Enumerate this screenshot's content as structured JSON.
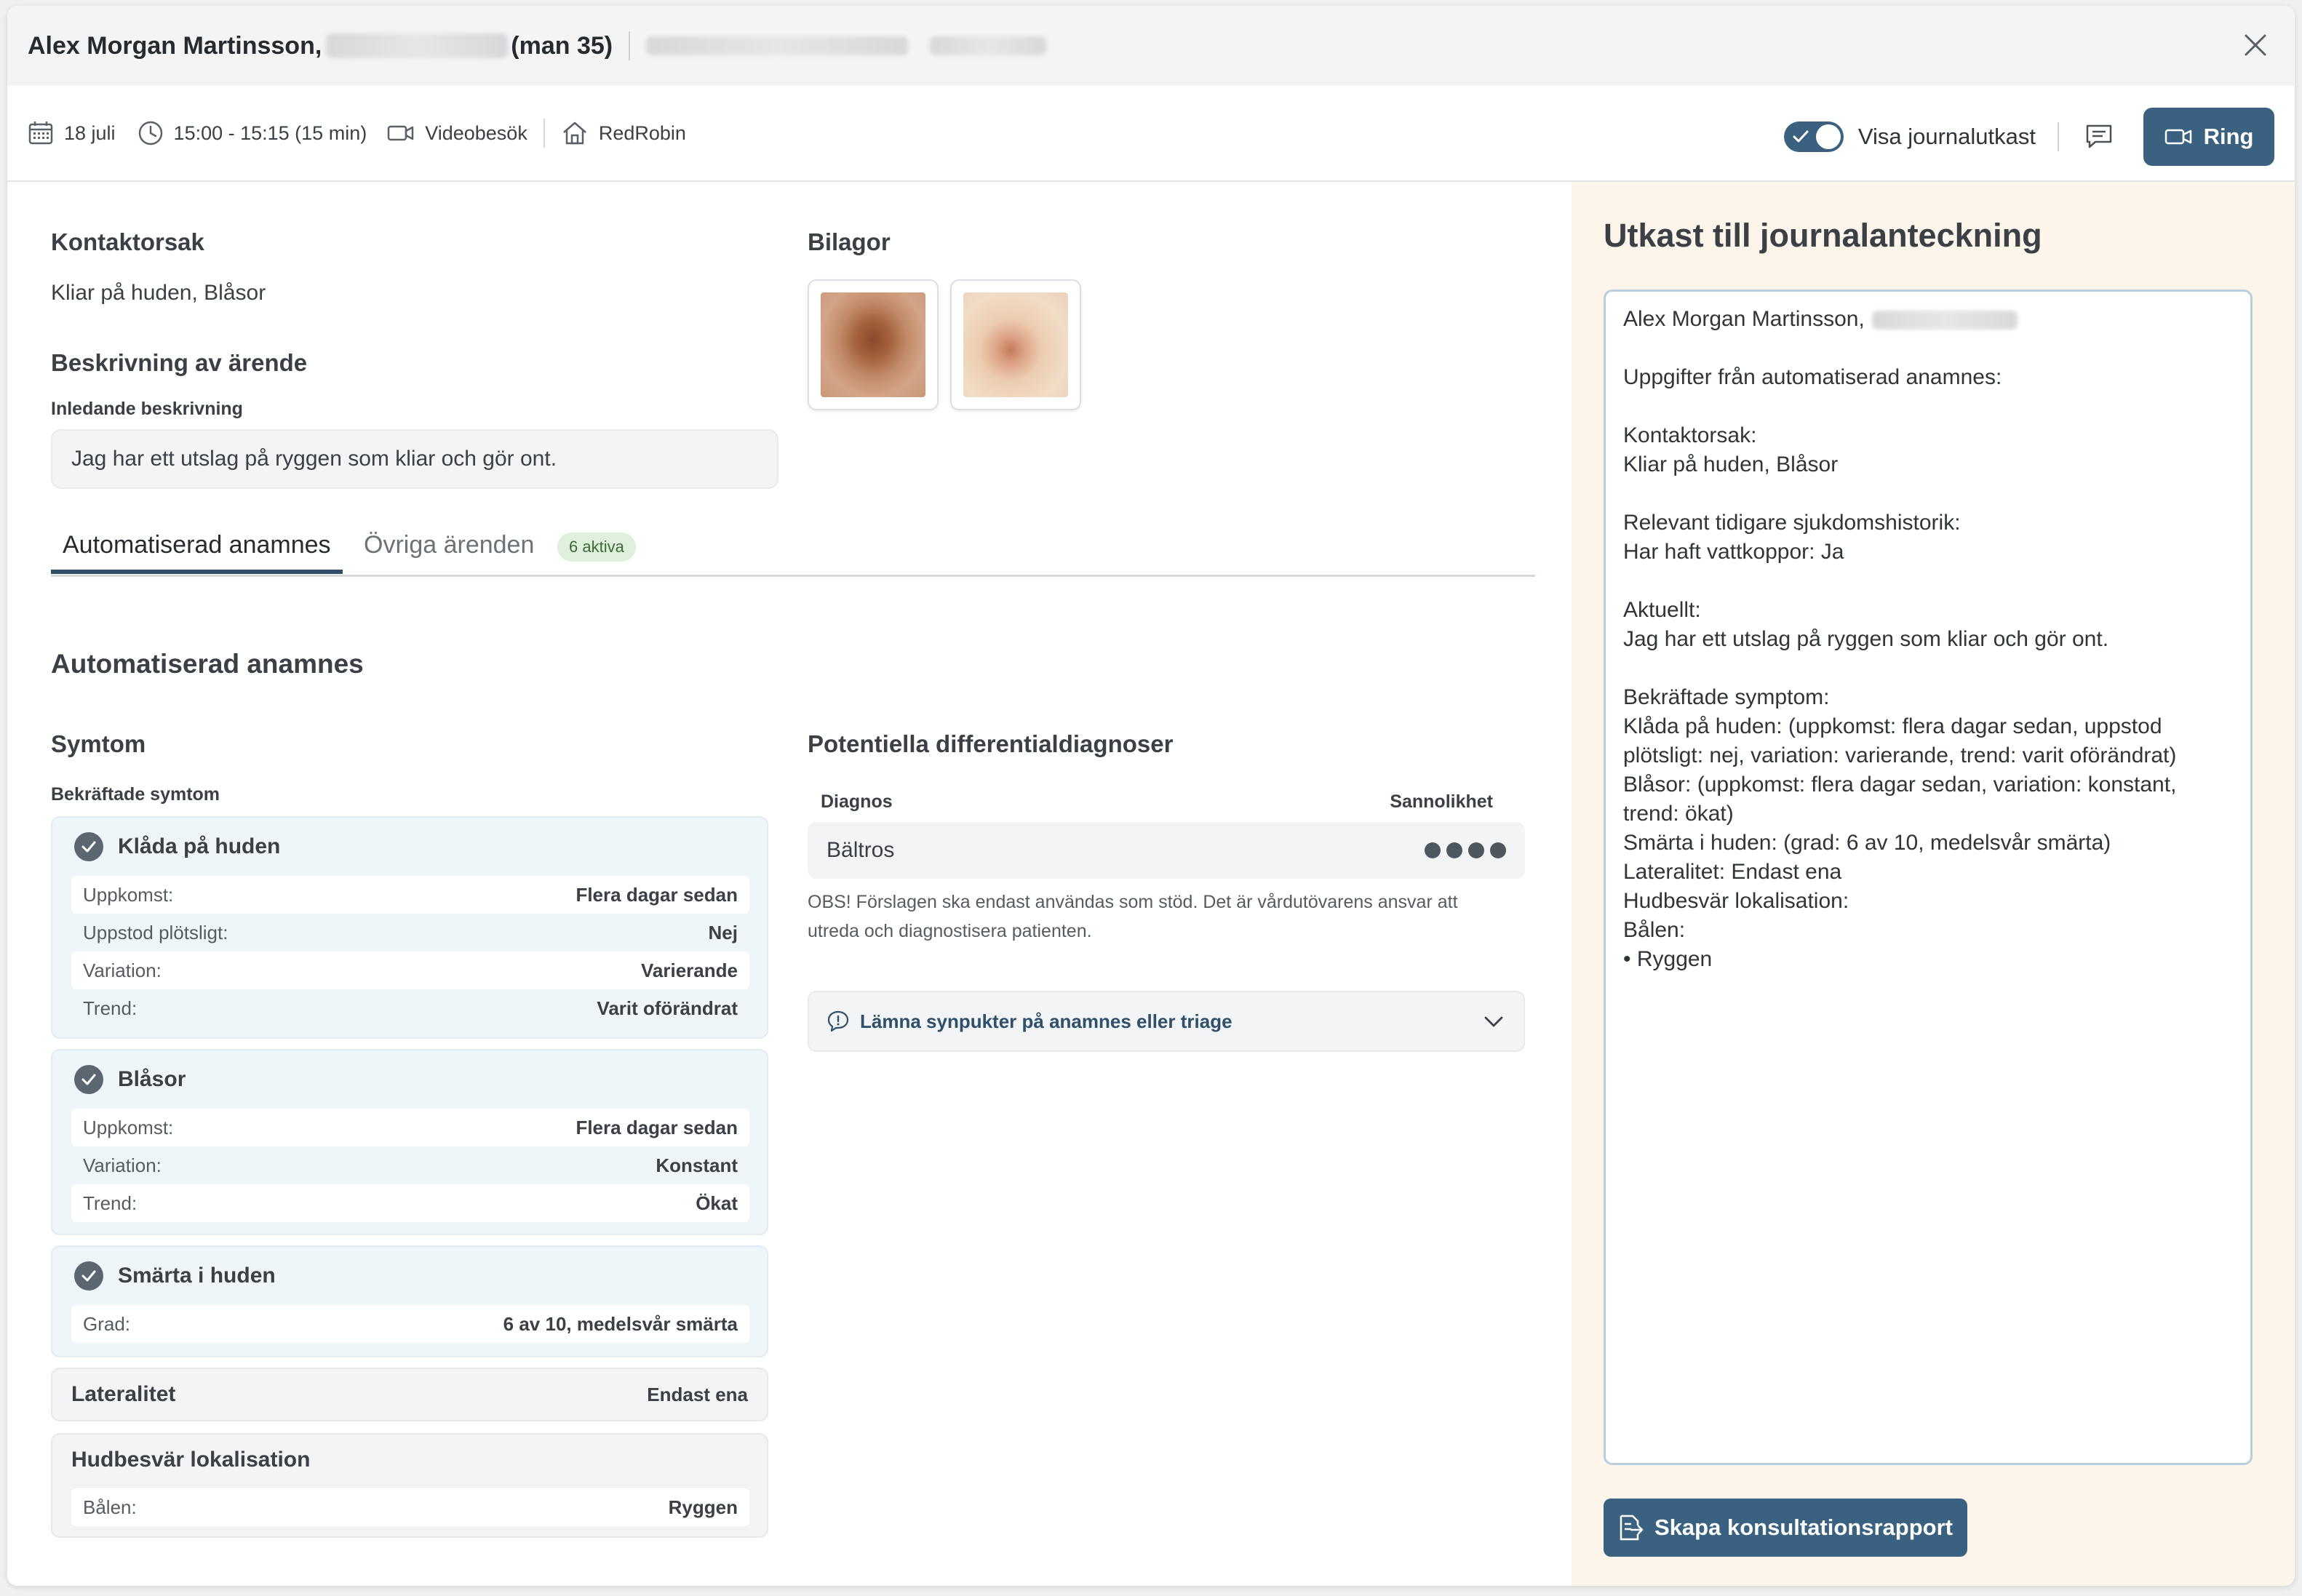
{
  "header": {
    "patient_name": "Alex Morgan Martinsson,",
    "age_gender": "(man 35)"
  },
  "toolbar": {
    "date": "18 juli",
    "time": "15:00 - 15:15 (15 min)",
    "visit_type": "Videobesök",
    "clinic": "RedRobin",
    "toggle_label": "Visa journalutkast",
    "ring_label": "Ring"
  },
  "main": {
    "contact_reason_title": "Kontaktorsak",
    "contact_reason": "Kliar på huden, Blåsor",
    "description_title": "Beskrivning av ärende",
    "initial_description_label": "Inledande beskrivning",
    "initial_description": "Jag har ett utslag på ryggen som kliar och gör ont.",
    "attachments_title": "Bilagor",
    "tabs": [
      {
        "label": "Automatiserad anamnes"
      },
      {
        "label": "Övriga ärenden",
        "badge": "6 aktiva"
      }
    ],
    "anamnes_title": "Automatiserad anamnes",
    "symptoms_title": "Symtom",
    "confirmed_label": "Bekräftade symtom",
    "symptoms": [
      {
        "name": "Klåda på huden",
        "rows": [
          {
            "k": "Uppkomst:",
            "v": "Flera dagar sedan"
          },
          {
            "k": "Uppstod plötsligt:",
            "v": "Nej"
          },
          {
            "k": "Variation:",
            "v": "Varierande"
          },
          {
            "k": "Trend:",
            "v": "Varit oförändrat"
          }
        ]
      },
      {
        "name": "Blåsor",
        "rows": [
          {
            "k": "Uppkomst:",
            "v": "Flera dagar sedan"
          },
          {
            "k": "Variation:",
            "v": "Konstant"
          },
          {
            "k": "Trend:",
            "v": "Ökat"
          }
        ]
      },
      {
        "name": "Smärta i huden",
        "rows": [
          {
            "k": "Grad:",
            "v": "6 av 10, medelsvår smärta"
          }
        ]
      }
    ],
    "laterality": {
      "label": "Lateralitet",
      "value": "Endast ena"
    },
    "localisation": {
      "label": "Hudbesvär lokalisation",
      "k": "Bålen:",
      "v": "Ryggen"
    },
    "differential_title": "Potentiella differentialdiagnoser",
    "diag_col": "Diagnos",
    "prob_col": "Sannolikhet",
    "diagnoses": [
      {
        "name": "Bältros",
        "probability_level": 4
      }
    ],
    "obs_text": "OBS! Förslagen ska endast användas som stöd. Det är vårdutövarens ansvar att utreda och diagnostisera patienten.",
    "feedback_label": "Lämna synpukter på anamnes eller triage"
  },
  "right_panel": {
    "title": "Utkast till journalanteckning",
    "draft_lines": [
      "Alex Morgan Martinsson,",
      "",
      "Uppgifter från automatiserad anamnes:",
      "",
      "Kontaktorsak:",
      "Kliar på huden, Blåsor",
      "",
      "Relevant tidigare sjukdomshistorik:",
      "Har haft vattkoppor: Ja",
      "",
      "Aktuellt:",
      "Jag har ett utslag på ryggen som kliar och gör ont.",
      "",
      "Bekräftade symptom:",
      "Klåda på huden: (uppkomst: flera dagar sedan, uppstod",
      "plötsligt: nej, variation: varierande, trend: varit oförändrat)",
      "Blåsor: (uppkomst: flera dagar sedan, variation: konstant,",
      "trend: ökat)",
      "Smärta i huden: (grad: 6 av 10, medelsvår smärta)",
      "Lateralitet: Endast ena",
      "Hudbesvär lokalisation:",
      "Bålen:",
      "• Ryggen"
    ],
    "report_button": "Skapa konsultationsrapport"
  },
  "colors": {
    "accent": "#3a6280",
    "draft_panel_bg": "#fdf5ea",
    "symptom_card_bg": "#eef6fa",
    "badge_bg": "#dff0dc"
  }
}
